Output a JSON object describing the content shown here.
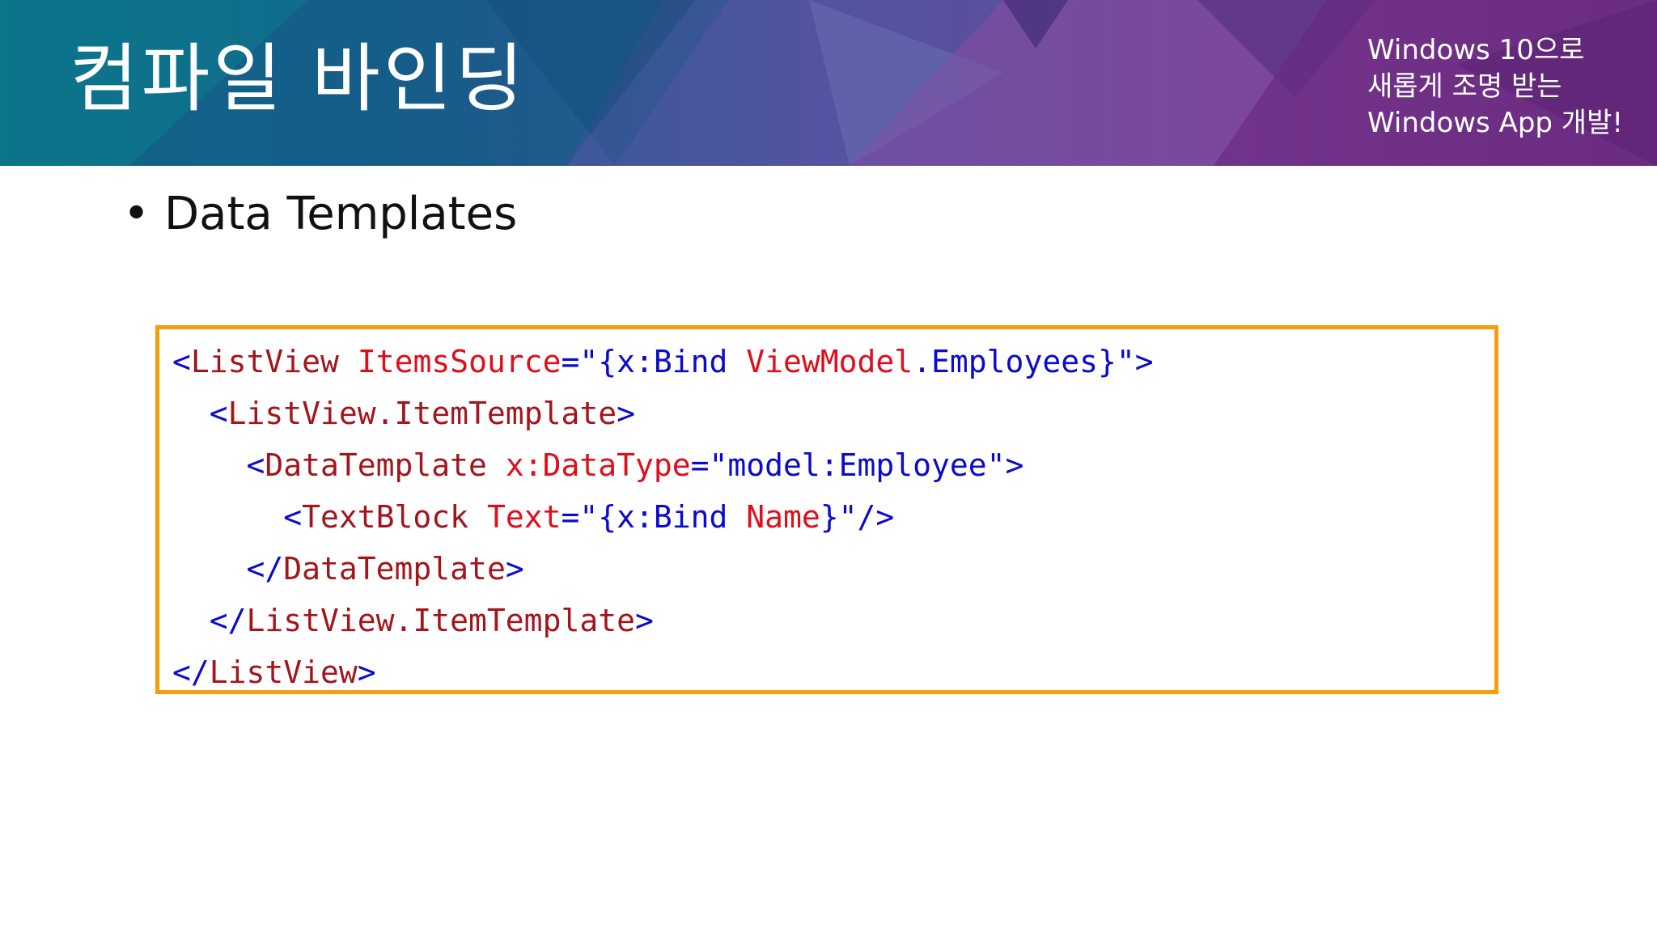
{
  "header": {
    "title": "컴파일 바인딩",
    "tagline": [
      "Windows 10으로",
      "새롭게 조명 받는",
      "Windows App 개발!"
    ]
  },
  "content": {
    "bullet_symbol": "•",
    "bullet_text": "Data Templates"
  },
  "code": {
    "border_color": "#f59d0c",
    "colors": {
      "punctuation": "#0a0ad0",
      "attribute": "#e00e1a",
      "element": "#a3151c"
    },
    "lines": [
      [
        {
          "t": "<",
          "c": "blue"
        },
        {
          "t": "ListView",
          "c": "dark"
        },
        {
          "t": " ",
          "c": "blue"
        },
        {
          "t": "ItemsSource",
          "c": "red"
        },
        {
          "t": "=\"{x:Bind ",
          "c": "blue"
        },
        {
          "t": "ViewModel",
          "c": "red"
        },
        {
          "t": ".Employees}\">",
          "c": "blue"
        }
      ],
      [
        {
          "t": "  <",
          "c": "blue"
        },
        {
          "t": "ListView.ItemTemplate",
          "c": "dark"
        },
        {
          "t": ">",
          "c": "blue"
        }
      ],
      [
        {
          "t": "    <",
          "c": "blue"
        },
        {
          "t": "DataTemplate",
          "c": "dark"
        },
        {
          "t": " ",
          "c": "blue"
        },
        {
          "t": "x:DataType",
          "c": "red"
        },
        {
          "t": "=\"model:Employee\">",
          "c": "blue"
        }
      ],
      [
        {
          "t": "      <",
          "c": "blue"
        },
        {
          "t": "TextBlock",
          "c": "dark"
        },
        {
          "t": " ",
          "c": "blue"
        },
        {
          "t": "Text",
          "c": "red"
        },
        {
          "t": "=\"{x:Bind ",
          "c": "blue"
        },
        {
          "t": "Name",
          "c": "red"
        },
        {
          "t": "}\"/>",
          "c": "blue"
        }
      ],
      [
        {
          "t": "    </",
          "c": "blue"
        },
        {
          "t": "DataTemplate",
          "c": "dark"
        },
        {
          "t": ">",
          "c": "blue"
        }
      ],
      [
        {
          "t": "  </",
          "c": "blue"
        },
        {
          "t": "ListView.ItemTemplate",
          "c": "dark"
        },
        {
          "t": ">",
          "c": "blue"
        }
      ],
      [
        {
          "t": "</",
          "c": "blue"
        },
        {
          "t": "ListView",
          "c": "dark"
        },
        {
          "t": ">",
          "c": "blue"
        }
      ]
    ]
  }
}
